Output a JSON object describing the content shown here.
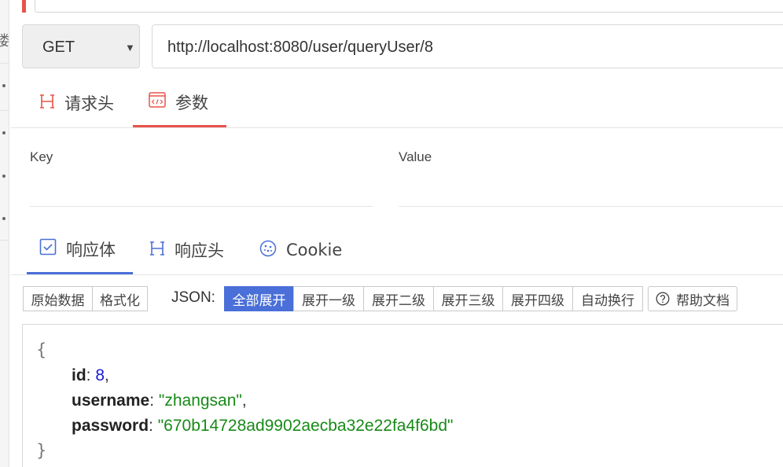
{
  "request": {
    "method": "GET",
    "method_arrow": "▼",
    "url": "http://localhost:8080/user/queryUser/8"
  },
  "request_tabs": [
    {
      "label": "请求头",
      "icon": "H"
    },
    {
      "label": "参数",
      "icon": "</>"
    }
  ],
  "params": {
    "key_header": "Key",
    "value_header": "Value"
  },
  "response_tabs": [
    {
      "label": "响应体"
    },
    {
      "label": "响应头",
      "icon": "H"
    },
    {
      "label": "Cookie"
    }
  ],
  "toolbar": {
    "raw": "原始数据",
    "format": "格式化",
    "json_label": "JSON:",
    "expand_all": "全部展开",
    "expand_1": "展开一级",
    "expand_2": "展开二级",
    "expand_3": "展开三级",
    "expand_4": "展开四级",
    "wrap": "自动换行",
    "help": "帮助文档"
  },
  "response_json": {
    "open": "{",
    "close": "}",
    "fields": [
      {
        "key": "id",
        "value": "8",
        "type": "number",
        "trail": ","
      },
      {
        "key": "username",
        "value": "\"zhangsan\"",
        "type": "string",
        "trail": ","
      },
      {
        "key": "password",
        "value": "\"670b14728ad9902aecba32e22fa4f6bd\"",
        "type": "string",
        "trail": ""
      }
    ]
  },
  "sidebar": {
    "glyph": "喽"
  },
  "colors": {
    "accent_red": "#e8534a",
    "accent_blue": "#4a6fd8",
    "json_number": "#1a1ad6",
    "json_string": "#178a17"
  }
}
